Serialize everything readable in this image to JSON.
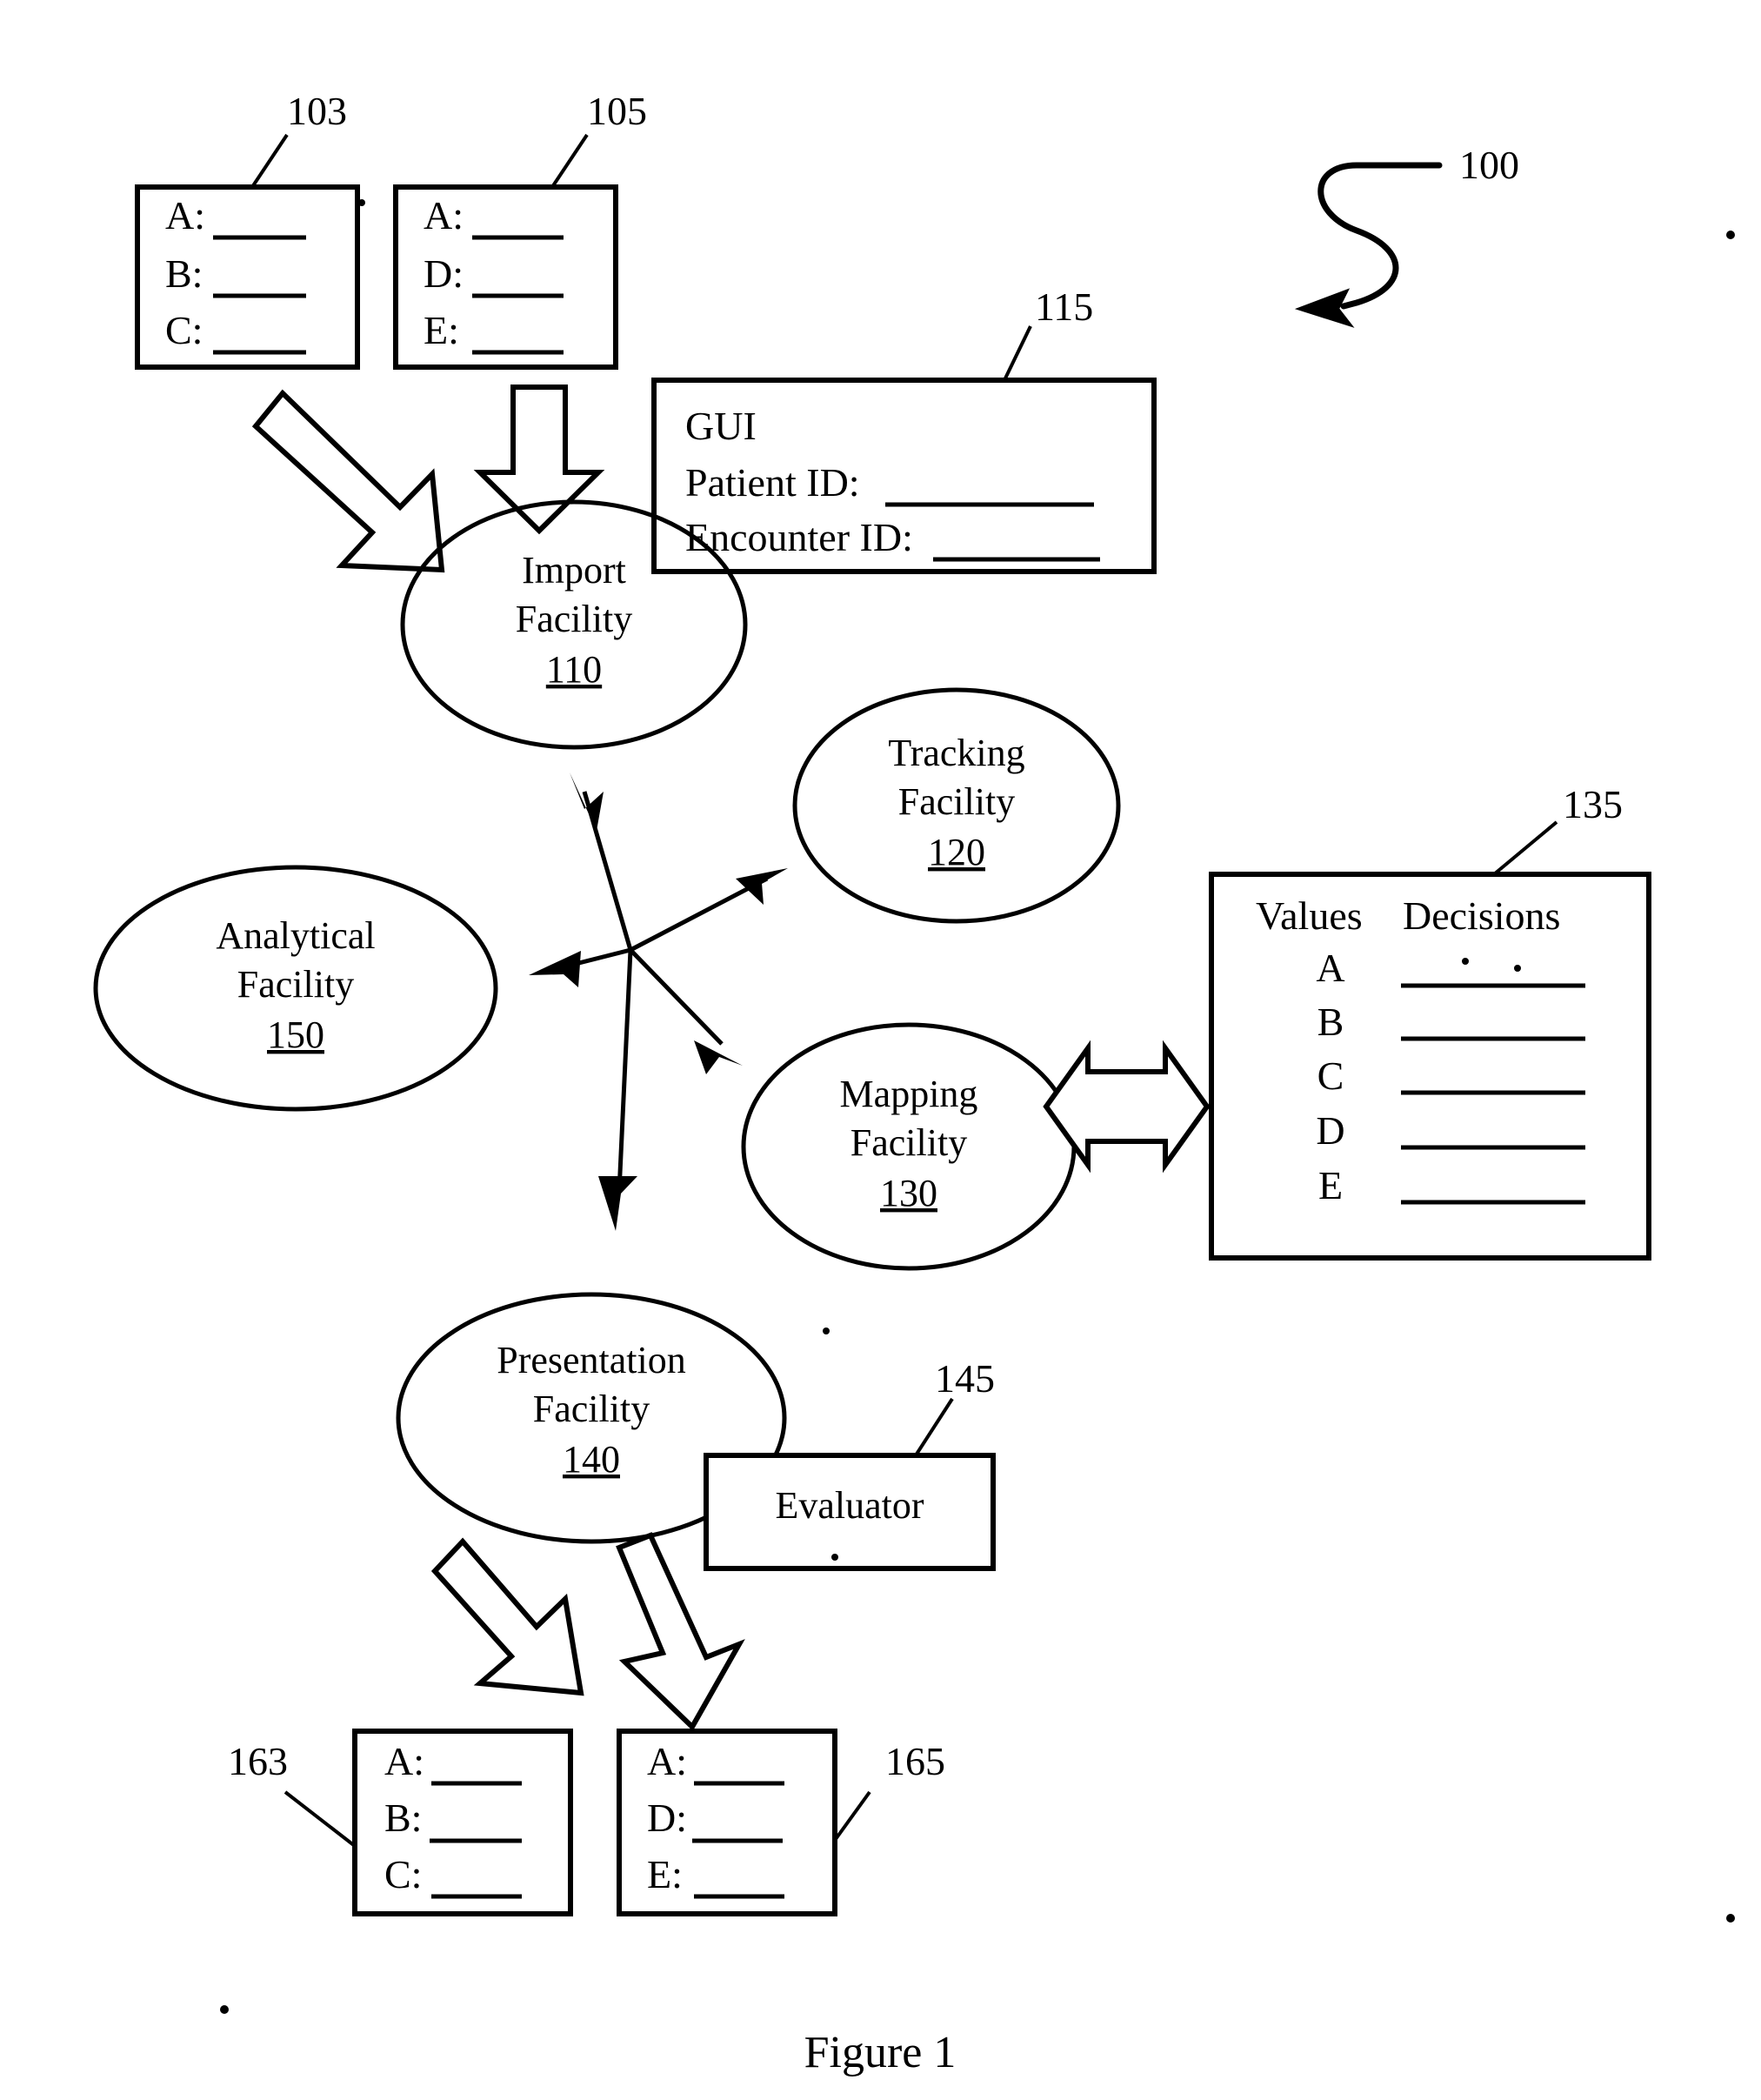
{
  "figure": {
    "caption": "Figure 1",
    "system_ref": "100"
  },
  "source_records": [
    {
      "ref": "103",
      "name": "source-record-103",
      "fields": [
        "A:",
        "B:",
        "C:"
      ]
    },
    {
      "ref": "105",
      "name": "source-record-105",
      "fields": [
        "A:",
        "D:",
        "E:"
      ]
    }
  ],
  "gui": {
    "ref": "115",
    "title": "GUI",
    "fields": [
      {
        "label": "Patient ID:"
      },
      {
        "label": "Encounter ID:"
      }
    ]
  },
  "facilities": [
    {
      "ref": "110",
      "line1": "Import",
      "line2": "Facility"
    },
    {
      "ref": "120",
      "line1": "Tracking",
      "line2": "Facility"
    },
    {
      "ref": "150",
      "line1": "Analytical",
      "line2": "Facility"
    },
    {
      "ref": "130",
      "line1": "Mapping",
      "line2": "Facility"
    },
    {
      "ref": "140",
      "line1": "Presentation",
      "line2": "Facility"
    }
  ],
  "evaluator": {
    "ref": "145",
    "label": "Evaluator"
  },
  "decision_table": {
    "ref": "135",
    "headers": [
      "Values",
      "Decisions"
    ],
    "rows": [
      "A",
      "B",
      "C",
      "D",
      "E"
    ]
  },
  "output_records": [
    {
      "ref": "163",
      "name": "output-record-163",
      "fields": [
        "A:",
        "B:",
        "C:"
      ]
    },
    {
      "ref": "165",
      "name": "output-record-165",
      "fields": [
        "A:",
        "D:",
        "E:"
      ]
    }
  ],
  "colors": {
    "ink": "#000000",
    "paper": "#ffffff"
  }
}
